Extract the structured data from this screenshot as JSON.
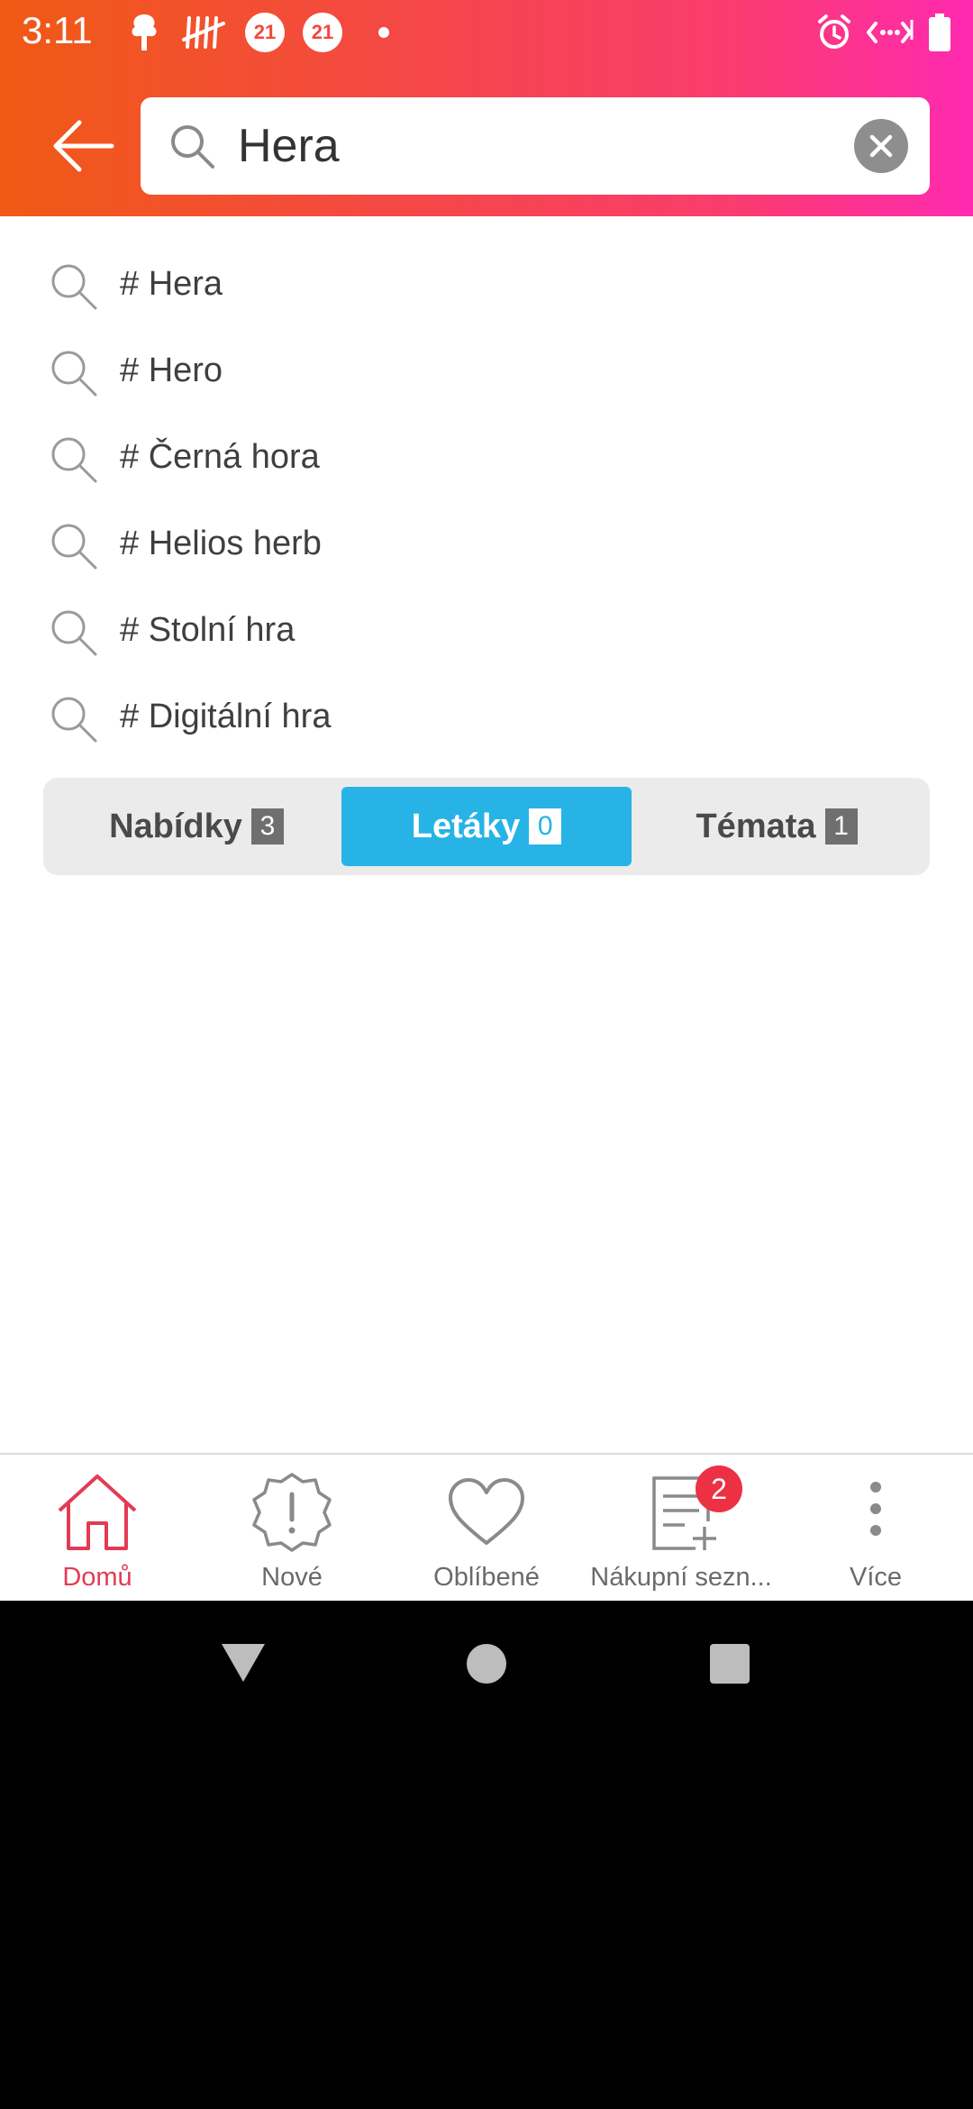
{
  "status_bar": {
    "time": "3:11",
    "notif_badge_1": "21",
    "notif_badge_2": "21"
  },
  "search": {
    "query": "Hera",
    "placeholder": ""
  },
  "suggestions": [
    {
      "label": "# Hera"
    },
    {
      "label": "# Hero"
    },
    {
      "label": "# Černá hora"
    },
    {
      "label": "# Helios herb"
    },
    {
      "label": "# Stolní hra"
    },
    {
      "label": "# Digitální hra"
    }
  ],
  "tabs": [
    {
      "label": "Nabídky",
      "count": "3",
      "selected": false
    },
    {
      "label": "Letáky",
      "count": "0",
      "selected": true
    },
    {
      "label": "Témata",
      "count": "1",
      "selected": false
    }
  ],
  "bottom_nav": {
    "home": "Domů",
    "new": "Nové",
    "favorites": "Oblíbené",
    "shopping_list": "Nákupní sezn...",
    "shopping_list_badge": "2",
    "more": "Více"
  },
  "colors": {
    "accent_red": "#e23b55",
    "tab_active": "#27b3e6",
    "badge": "#ec3145"
  },
  "icons": {
    "back": "arrow-left-icon",
    "search": "search-icon",
    "clear": "clear-icon",
    "home": "home-icon",
    "new": "alert-badge-icon",
    "favorites": "heart-icon",
    "shopping_list": "list-add-icon",
    "more": "more-vertical-icon"
  }
}
